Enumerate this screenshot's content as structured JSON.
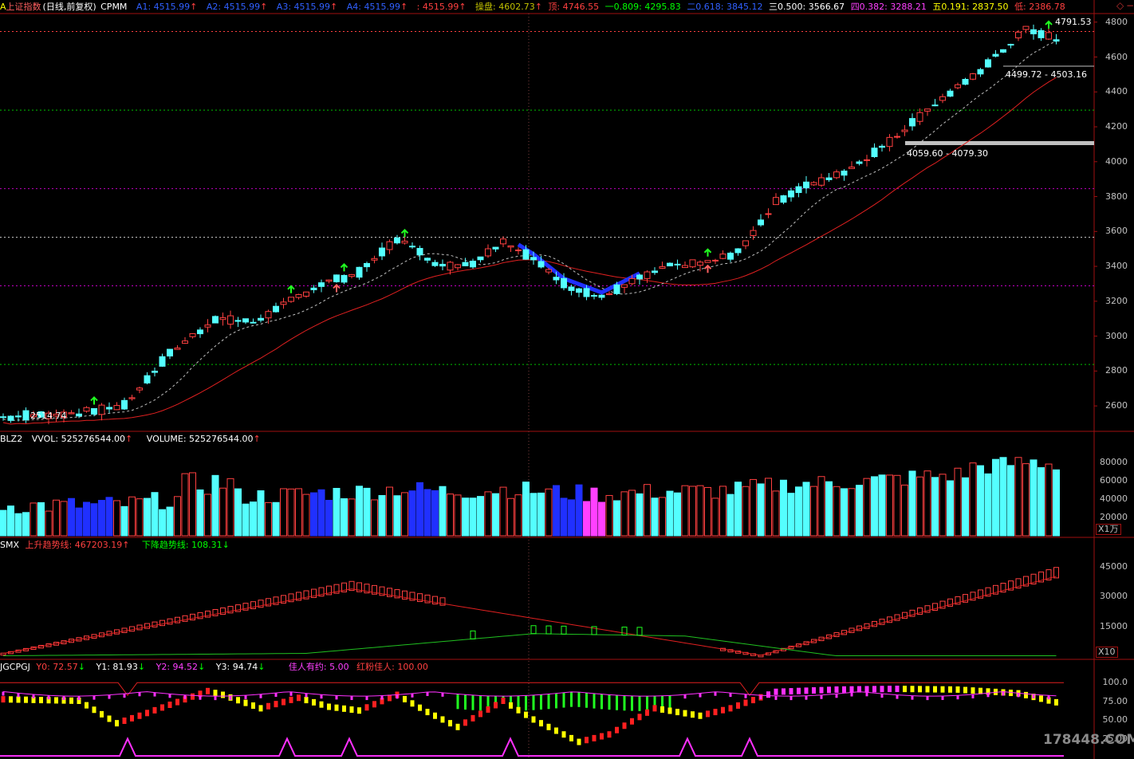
{
  "header_main": {
    "title": "上证指数",
    "title_suffix": "(日线,前复权)",
    "indicator": "CPMM",
    "a1": "A1: 4515.99",
    "a2": "A2: 4515.99",
    "a3": "A3: 4515.99",
    "a4": "A4: 4515.99",
    "a5": ": 4515.99",
    "op": "操盘: 4602.73",
    "top": "顶: 4746.55",
    "l1": "一0.809: 4295.83",
    "l2": "二0.618: 3845.12",
    "l3": "三0.500: 3566.67",
    "l4": "四0.382: 3288.21",
    "l5": "五0.191: 2837.50",
    "low": "低: 2386.78"
  },
  "main_annotations": {
    "high_label": "4791.53",
    "low_label": "2514.74",
    "zone1": "4499.72 - 4503.16",
    "zone2": "4059.60 - 4079.30"
  },
  "main_axis": [
    "4800",
    "4600",
    "4400",
    "4200",
    "4000",
    "3800",
    "3600",
    "3400",
    "3200",
    "3000",
    "2800",
    "2600"
  ],
  "header_vol": {
    "name": "BLZ2",
    "vvol": "VVOL: 525276544.00",
    "volume": "VOLUME: 525276544.00"
  },
  "vol_axis": [
    "80000",
    "60000",
    "40000",
    "20000"
  ],
  "vol_unit": "X1万",
  "header_smx": {
    "name": "SMX",
    "up": "上升趋势线: 467203.19",
    "down": "下降趋势线: 108.31"
  },
  "smx_axis": [
    "45000",
    "30000",
    "15000"
  ],
  "smx_unit": "X10",
  "header_jg": {
    "name": "JGCPGJ",
    "y0": "Y0: 72.57",
    "y1": "Y1: 81.93",
    "y2": "Y2: 94.52",
    "y3": "Y3: 94.74",
    "p1": "佳人有约: 5.00",
    "p2": "红粉佳人: 100.00"
  },
  "jg_axis": [
    "100.0",
    "75.00",
    "50.00",
    "25.00"
  ],
  "watermark": "178448.COM",
  "colors": {
    "up": "#ff4040",
    "down": "#54ffff",
    "ma": "#e02020",
    "grid_yellow": "#c0c000",
    "grid_magenta": "#c000c0",
    "grid_green": "#00c000"
  }
}
